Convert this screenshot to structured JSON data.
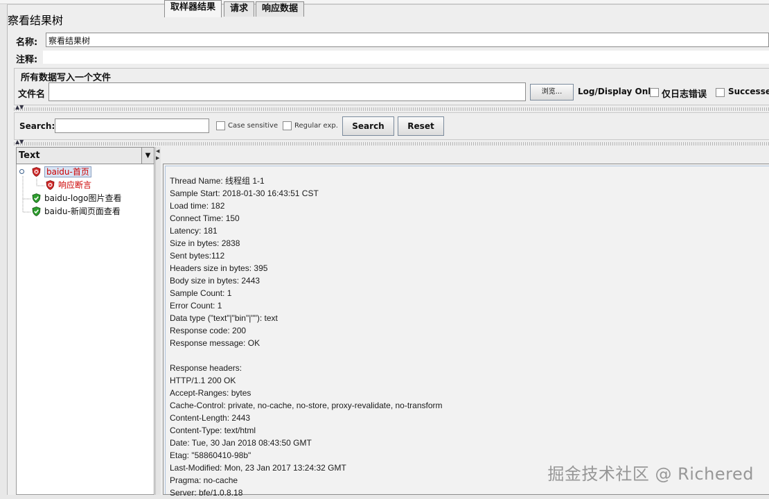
{
  "panel": {
    "title": "察看结果树"
  },
  "form": {
    "name_label": "名称:",
    "name_value": "察看结果树",
    "comment_label": "注释:",
    "comment_value": ""
  },
  "file_group": {
    "title": "所有数据写入一个文件",
    "filename_label": "文件名",
    "filename_value": "",
    "browse_label": "浏览...",
    "log_display_label": "Log/Display Only:",
    "errors_only_label": "仅日志错误",
    "successes_label": "Successes"
  },
  "search": {
    "label": "Search:",
    "value": "",
    "case_sensitive_label": "Case sensitive",
    "regex_label": "Regular exp.",
    "search_button": "Search",
    "reset_button": "Reset"
  },
  "renderer": {
    "selected": "Text"
  },
  "tree": {
    "items": [
      {
        "label": "baidu-首页",
        "status": "error"
      },
      {
        "label": "响应断言",
        "status": "error"
      },
      {
        "label": "baidu-logo图片查看",
        "status": "success"
      },
      {
        "label": "baidu-新闻页面查看",
        "status": "success"
      }
    ]
  },
  "tabs": [
    {
      "label": "取样器结果"
    },
    {
      "label": "请求"
    },
    {
      "label": "响应数据"
    }
  ],
  "result_lines": [
    "Thread Name: 线程组 1-1",
    "Sample Start: 2018-01-30 16:43:51 CST",
    "Load time: 182",
    "Connect Time: 150",
    "Latency: 181",
    "Size in bytes: 2838",
    "Sent bytes:112",
    "Headers size in bytes: 395",
    "Body size in bytes: 2443",
    "Sample Count: 1",
    "Error Count: 1",
    "Data type (\"text\"|\"bin\"|\"\"): text",
    "Response code: 200",
    "Response message: OK",
    "",
    "Response headers:",
    "HTTP/1.1 200 OK",
    "Accept-Ranges: bytes",
    "Cache-Control: private, no-cache, no-store, proxy-revalidate, no-transform",
    "Content-Length: 2443",
    "Content-Type: text/html",
    "Date: Tue, 30 Jan 2018 08:43:50 GMT",
    "Etag: \"58860410-98b\"",
    "Last-Modified: Mon, 23 Jan 2017 13:24:32 GMT",
    "Pragma: no-cache",
    "Server: bfe/1.0.8.18"
  ],
  "watermark": "掘金技术社区 @ Richered",
  "colors": {
    "error": "#cc0000",
    "success": "#2e9e2e",
    "selection": "#d8e4f4"
  },
  "icons": {
    "error": "error-shield-icon",
    "success": "success-shield-icon"
  }
}
